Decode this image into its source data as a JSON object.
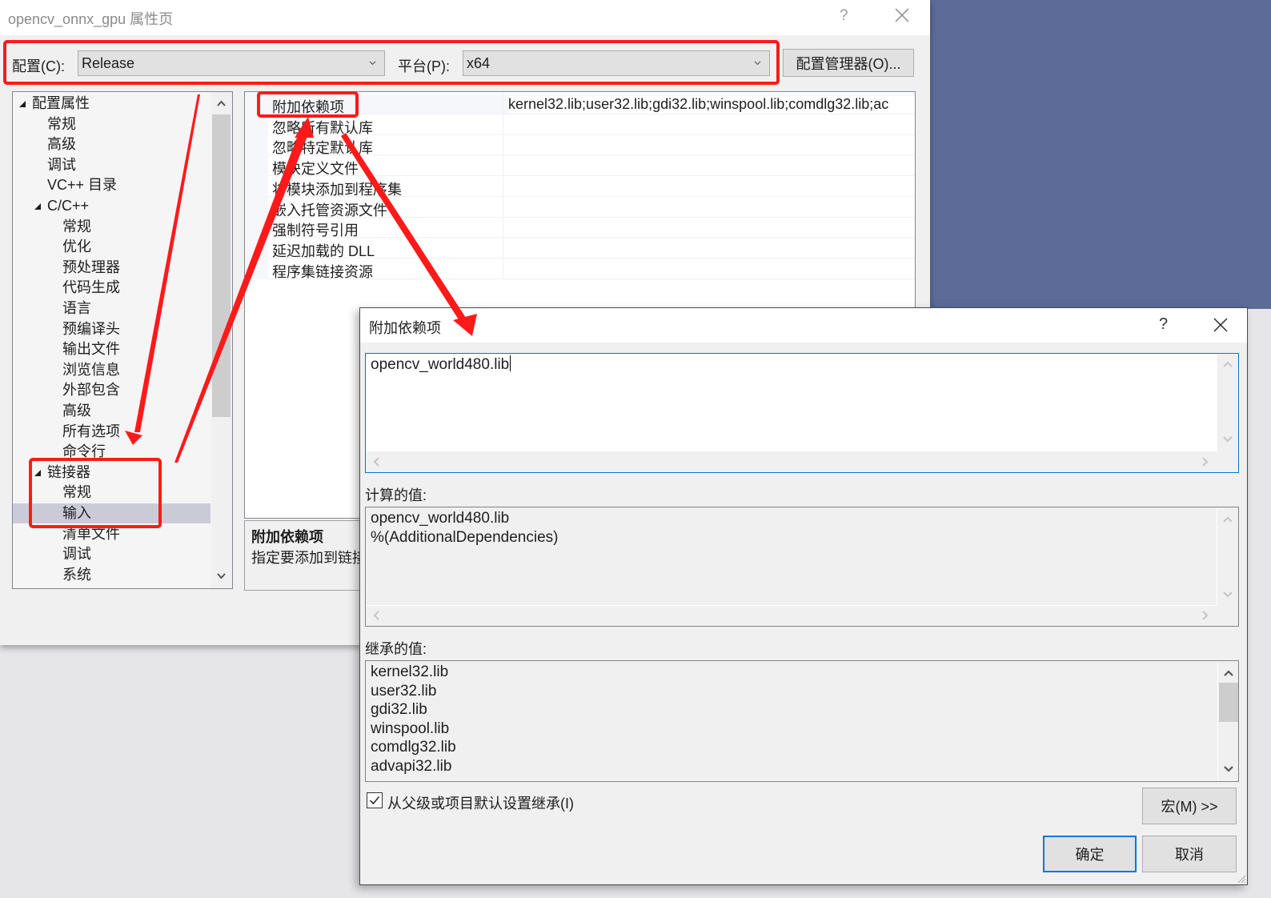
{
  "main_window": {
    "title": "opencv_onnx_gpu 属性页",
    "help_glyph": "?",
    "config_label": "配置(C):",
    "config_value": "Release",
    "platform_label": "平台(P):",
    "platform_value": "x64",
    "config_manager_button": "配置管理器(O)..."
  },
  "tree": {
    "items": [
      {
        "label": "配置属性",
        "level": 0,
        "expanded": true
      },
      {
        "label": "常规",
        "level": 1
      },
      {
        "label": "高级",
        "level": 1
      },
      {
        "label": "调试",
        "level": 1
      },
      {
        "label": "VC++ 目录",
        "level": 1
      },
      {
        "label": "C/C++",
        "level": 1,
        "expanded": true
      },
      {
        "label": "常规",
        "level": 2
      },
      {
        "label": "优化",
        "level": 2
      },
      {
        "label": "预处理器",
        "level": 2
      },
      {
        "label": "代码生成",
        "level": 2
      },
      {
        "label": "语言",
        "level": 2
      },
      {
        "label": "预编译头",
        "level": 2
      },
      {
        "label": "输出文件",
        "level": 2
      },
      {
        "label": "浏览信息",
        "level": 2
      },
      {
        "label": "外部包含",
        "level": 2
      },
      {
        "label": "高级",
        "level": 2
      },
      {
        "label": "所有选项",
        "level": 2
      },
      {
        "label": "命令行",
        "level": 2
      },
      {
        "label": "链接器",
        "level": 1,
        "expanded": true
      },
      {
        "label": "常规",
        "level": 2
      },
      {
        "label": "输入",
        "level": 2,
        "selected": true
      },
      {
        "label": "清单文件",
        "level": 2
      },
      {
        "label": "调试",
        "level": 2
      },
      {
        "label": "系统",
        "level": 2
      }
    ]
  },
  "property_grid": {
    "rows": [
      {
        "name": "附加依赖项",
        "value": "kernel32.lib;user32.lib;gdi32.lib;winspool.lib;comdlg32.lib;ac"
      },
      {
        "name": "忽略所有默认库",
        "value": ""
      },
      {
        "name": "忽略特定默认库",
        "value": ""
      },
      {
        "name": "模块定义文件",
        "value": ""
      },
      {
        "name": "将模块添加到程序集",
        "value": ""
      },
      {
        "name": "嵌入托管资源文件",
        "value": ""
      },
      {
        "name": "强制符号引用",
        "value": ""
      },
      {
        "name": "延迟加载的 DLL",
        "value": ""
      },
      {
        "name": "程序集链接资源",
        "value": ""
      }
    ]
  },
  "description": {
    "title": "附加依赖项",
    "text": "指定要添加到链接"
  },
  "dialog": {
    "title": "附加依赖项",
    "help_glyph": "?",
    "edit_value": "opencv_world480.lib",
    "computed_label": "计算的值:",
    "computed_lines": [
      "opencv_world480.lib",
      "%(AdditionalDependencies)"
    ],
    "inherited_label": "继承的值:",
    "inherited_lines": [
      "kernel32.lib",
      "user32.lib",
      "gdi32.lib",
      "winspool.lib",
      "comdlg32.lib",
      "advapi32.lib"
    ],
    "inherit_checkbox_label": "从父级或项目默认设置继承(I)",
    "inherit_checked": true,
    "macro_button": "宏(M) >>",
    "ok_button": "确定",
    "cancel_button": "取消"
  },
  "colors": {
    "annotation_red": "#ff1a1a",
    "focus_blue": "#0078d7",
    "desktop_blue": "#5d6b99",
    "selection": "#cbcbd8"
  }
}
